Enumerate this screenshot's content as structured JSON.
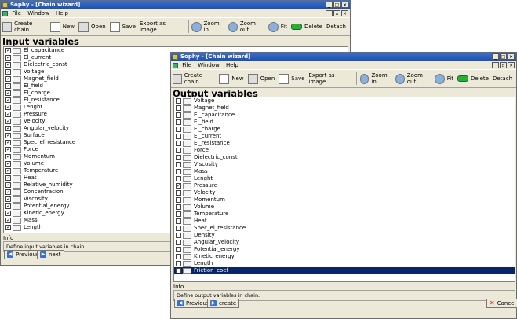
{
  "back_window": {
    "title": "Sophy - [Chain wizard]",
    "menu": [
      "File",
      "Window",
      "Help"
    ],
    "toolbar": [
      "Create chain",
      "New",
      "Open",
      "Save",
      "Export as image",
      "Zoom in",
      "Zoom out",
      "Fit",
      "Delete",
      "Detach"
    ],
    "heading": "Input variables",
    "items": [
      {
        "label": "El_capacitance",
        "checked": true
      },
      {
        "label": "El_current",
        "checked": true
      },
      {
        "label": "Dielectric_const",
        "checked": true
      },
      {
        "label": "Voltage",
        "checked": true
      },
      {
        "label": "Magnet_field",
        "checked": true
      },
      {
        "label": "El_field",
        "checked": true
      },
      {
        "label": "El_charge",
        "checked": true
      },
      {
        "label": "El_resistance",
        "checked": true
      },
      {
        "label": "Lenght",
        "checked": true
      },
      {
        "label": "Pressure",
        "checked": true
      },
      {
        "label": "Velocity",
        "checked": true
      },
      {
        "label": "Angular_velocity",
        "checked": true
      },
      {
        "label": "Surface",
        "checked": true
      },
      {
        "label": "Spec_el_resistance",
        "checked": true
      },
      {
        "label": "Force",
        "checked": true
      },
      {
        "label": "Momentum",
        "checked": true
      },
      {
        "label": "Volume",
        "checked": true
      },
      {
        "label": "Temperature",
        "checked": true
      },
      {
        "label": "Heat",
        "checked": true
      },
      {
        "label": "Relative_humidity",
        "checked": true
      },
      {
        "label": "Concentracion",
        "checked": true
      },
      {
        "label": "Viscosity",
        "checked": true
      },
      {
        "label": "Potential_energy",
        "checked": true
      },
      {
        "label": "Kinetic_energy",
        "checked": true
      },
      {
        "label": "Mass",
        "checked": true
      },
      {
        "label": "Length",
        "checked": true
      }
    ],
    "info_legend": "Info",
    "info_text": "Define input variables in chain.",
    "prev_label": "Previous",
    "next_label": "next"
  },
  "front_window": {
    "title": "Sophy - [Chain wizard]",
    "menu": [
      "File",
      "Window",
      "Help"
    ],
    "toolbar": [
      "Create chain",
      "New",
      "Open",
      "Save",
      "Export as image",
      "Zoom in",
      "Zoom out",
      "Fit",
      "Delete",
      "Detach"
    ],
    "heading": "Output variables",
    "items": [
      {
        "label": "Voltage",
        "checked": false
      },
      {
        "label": "Magnet_field",
        "checked": false
      },
      {
        "label": "El_capacitance",
        "checked": false
      },
      {
        "label": "El_field",
        "checked": false
      },
      {
        "label": "El_charge",
        "checked": false
      },
      {
        "label": "El_current",
        "checked": false
      },
      {
        "label": "El_resistance",
        "checked": false
      },
      {
        "label": "Force",
        "checked": false
      },
      {
        "label": "Dielectric_const",
        "checked": false
      },
      {
        "label": "Viscosity",
        "checked": false
      },
      {
        "label": "Mass",
        "checked": false
      },
      {
        "label": "Lenght",
        "checked": false
      },
      {
        "label": "Pressure",
        "checked": true
      },
      {
        "label": "Velocity",
        "checked": false
      },
      {
        "label": "Momentum",
        "checked": false
      },
      {
        "label": "Volume",
        "checked": false
      },
      {
        "label": "Temperature",
        "checked": false
      },
      {
        "label": "Heat",
        "checked": false
      },
      {
        "label": "Spec_el_resistance",
        "checked": false
      },
      {
        "label": "Density",
        "checked": false
      },
      {
        "label": "Angular_velocity",
        "checked": false
      },
      {
        "label": "Potential_energy",
        "checked": false
      },
      {
        "label": "Kinetic_energy",
        "checked": false
      },
      {
        "label": "Length",
        "checked": false
      },
      {
        "label": "Friction_coef",
        "checked": false,
        "selected": true
      }
    ],
    "info_legend": "Info",
    "info_text": "Define output variables in chain.",
    "prev_label": "Previous",
    "create_label": "create",
    "cancel_label": "Cancel"
  }
}
